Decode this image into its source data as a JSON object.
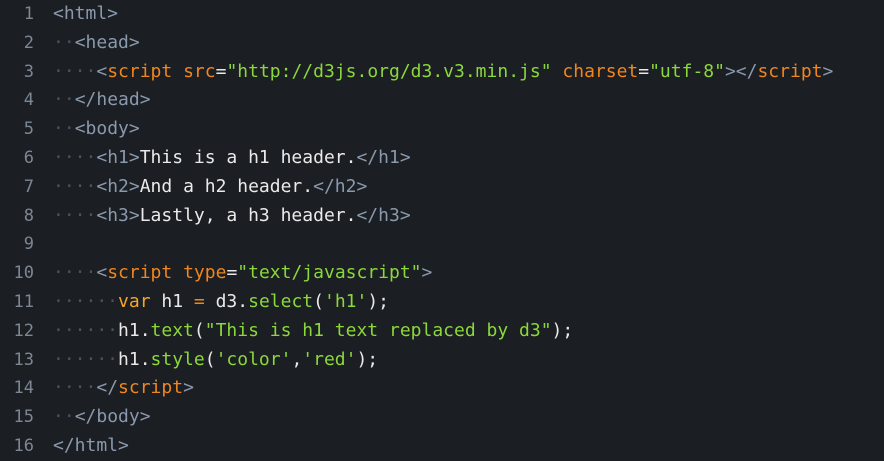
{
  "editor": {
    "lines": [
      {
        "num": "1",
        "indent": "",
        "tokens": [
          [
            "t-tag",
            "<html>"
          ]
        ]
      },
      {
        "num": "2",
        "indent": "··",
        "tokens": [
          [
            "t-tag",
            "<head>"
          ]
        ]
      },
      {
        "num": "3",
        "indent": "····",
        "tokens": [
          [
            "t-tag",
            "<"
          ],
          [
            "t-name",
            "script"
          ],
          [
            "t-plain",
            " "
          ],
          [
            "t-attr",
            "src"
          ],
          [
            "t-plain",
            "="
          ],
          [
            "t-str",
            "\"http://d3js.org/d3.v3.min.js\""
          ],
          [
            "t-plain",
            " "
          ],
          [
            "t-attr",
            "charset"
          ],
          [
            "t-plain",
            "="
          ],
          [
            "t-str",
            "\"utf-8\""
          ],
          [
            "t-tag",
            "></"
          ],
          [
            "t-name",
            "script"
          ],
          [
            "t-tag",
            ">"
          ]
        ]
      },
      {
        "num": "4",
        "indent": "··",
        "tokens": [
          [
            "t-tag",
            "</head>"
          ]
        ]
      },
      {
        "num": "5",
        "indent": "··",
        "tokens": [
          [
            "t-tag",
            "<body>"
          ]
        ]
      },
      {
        "num": "6",
        "indent": "····",
        "tokens": [
          [
            "t-tag",
            "<h1>"
          ],
          [
            "t-plain",
            "This is a h1 header."
          ],
          [
            "t-tag",
            "</h1>"
          ]
        ]
      },
      {
        "num": "7",
        "indent": "····",
        "tokens": [
          [
            "t-tag",
            "<h2>"
          ],
          [
            "t-plain",
            "And a h2 header."
          ],
          [
            "t-tag",
            "</h2>"
          ]
        ]
      },
      {
        "num": "8",
        "indent": "····",
        "tokens": [
          [
            "t-tag",
            "<h3>"
          ],
          [
            "t-plain",
            "Lastly, a h3 header."
          ],
          [
            "t-tag",
            "</h3>"
          ]
        ]
      },
      {
        "num": "9",
        "indent": "",
        "tokens": []
      },
      {
        "num": "10",
        "indent": "····",
        "tokens": [
          [
            "t-tag",
            "<"
          ],
          [
            "t-name",
            "script"
          ],
          [
            "t-plain",
            " "
          ],
          [
            "t-attr",
            "type"
          ],
          [
            "t-plain",
            "="
          ],
          [
            "t-str",
            "\"text/javascript\""
          ],
          [
            "t-tag",
            ">"
          ]
        ]
      },
      {
        "num": "11",
        "indent": "······",
        "tokens": [
          [
            "t-kw",
            "var"
          ],
          [
            "t-plain",
            " h1 "
          ],
          [
            "t-op",
            "="
          ],
          [
            "t-plain",
            " d3."
          ],
          [
            "t-fn",
            "select"
          ],
          [
            "t-plain",
            "("
          ],
          [
            "t-str",
            "'h1'"
          ],
          [
            "t-plain",
            ");"
          ]
        ]
      },
      {
        "num": "12",
        "indent": "······",
        "tokens": [
          [
            "t-plain",
            "h1."
          ],
          [
            "t-fn",
            "text"
          ],
          [
            "t-plain",
            "("
          ],
          [
            "t-str",
            "\"This is h1 text replaced by d3\""
          ],
          [
            "t-plain",
            ");"
          ]
        ]
      },
      {
        "num": "13",
        "indent": "······",
        "tokens": [
          [
            "t-plain",
            "h1."
          ],
          [
            "t-fn",
            "style"
          ],
          [
            "t-plain",
            "("
          ],
          [
            "t-str",
            "'color'"
          ],
          [
            "t-plain",
            ","
          ],
          [
            "t-str",
            "'red'"
          ],
          [
            "t-plain",
            ");"
          ]
        ]
      },
      {
        "num": "14",
        "indent": "····",
        "tokens": [
          [
            "t-tag",
            "</"
          ],
          [
            "t-name",
            "script"
          ],
          [
            "t-tag",
            ">"
          ]
        ]
      },
      {
        "num": "15",
        "indent": "··",
        "tokens": [
          [
            "t-tag",
            "</body>"
          ]
        ]
      },
      {
        "num": "16",
        "indent": "",
        "tokens": [
          [
            "t-tag",
            "</html>"
          ]
        ]
      }
    ]
  },
  "colors": {
    "background": "#1b1e22",
    "line_number": "#7d8794",
    "tag": "#8a99ad",
    "tag_name": "#f0861e",
    "string": "#8bd83a",
    "keyword": "#f5a623",
    "text": "#eaeaea"
  }
}
